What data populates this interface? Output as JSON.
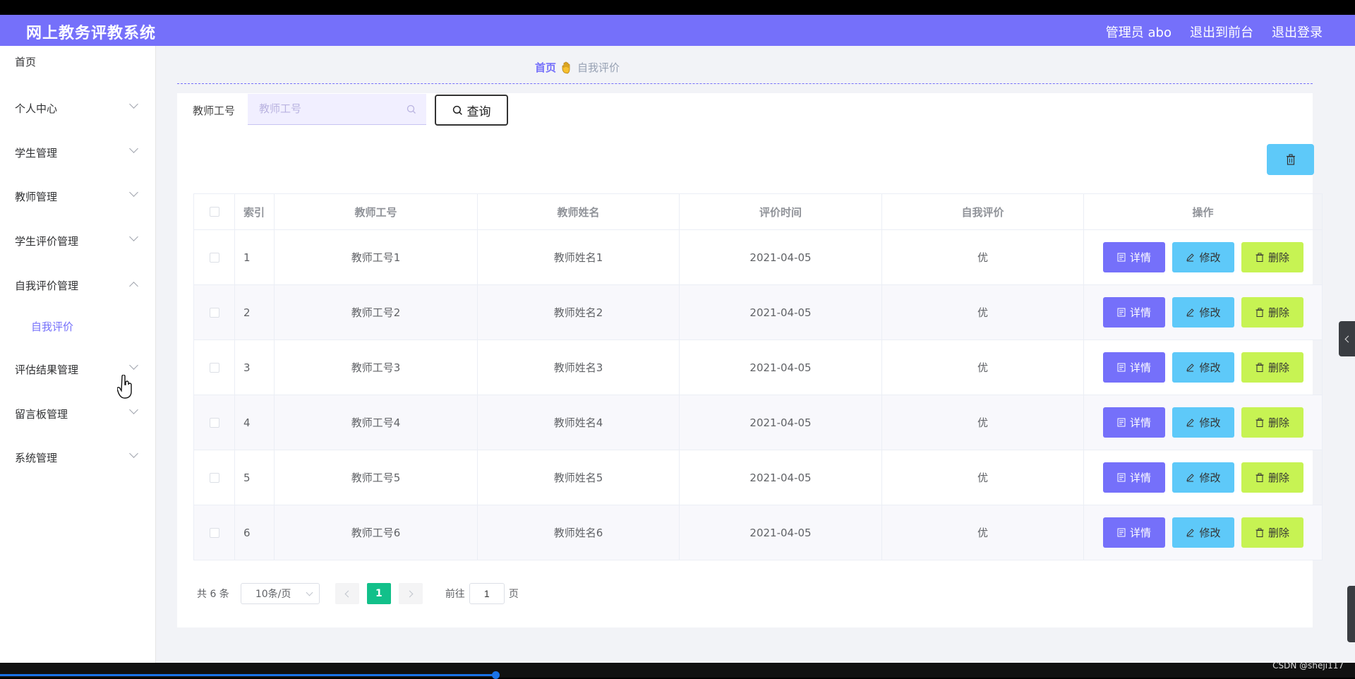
{
  "app": {
    "title": "网上教务评教系统",
    "top_nav": [
      "管理员 abo",
      "退出到前台",
      "退出登录"
    ]
  },
  "sidebar": {
    "items": [
      {
        "label": "首页",
        "has_arrow": false
      },
      {
        "label": "个人中心",
        "has_arrow": true
      },
      {
        "label": "学生管理",
        "has_arrow": true
      },
      {
        "label": "教师管理",
        "has_arrow": true
      },
      {
        "label": "学生评价管理",
        "has_arrow": true
      },
      {
        "label": "自我评价管理",
        "has_arrow": true,
        "expanded": true,
        "children": [
          "自我评价"
        ]
      },
      {
        "label": "评估结果管理",
        "has_arrow": true
      },
      {
        "label": "留言板管理",
        "has_arrow": true
      },
      {
        "label": "系统管理",
        "has_arrow": true
      }
    ]
  },
  "breadcrumb": {
    "home": "首页",
    "current": "自我评价"
  },
  "search": {
    "label": "教师工号",
    "placeholder": "教师工号",
    "value": "",
    "button_label": "查询"
  },
  "table": {
    "columns": [
      "索引",
      "教师工号",
      "教师姓名",
      "评价时间",
      "自我评价",
      "操作"
    ],
    "rows": [
      {
        "index": "1",
        "teacher_no": "教师工号1",
        "teacher_name": "教师姓名1",
        "eval_time": "2021-04-05",
        "self_eval": "优"
      },
      {
        "index": "2",
        "teacher_no": "教师工号2",
        "teacher_name": "教师姓名2",
        "eval_time": "2021-04-05",
        "self_eval": "优"
      },
      {
        "index": "3",
        "teacher_no": "教师工号3",
        "teacher_name": "教师姓名3",
        "eval_time": "2021-04-05",
        "self_eval": "优"
      },
      {
        "index": "4",
        "teacher_no": "教师工号4",
        "teacher_name": "教师姓名4",
        "eval_time": "2021-04-05",
        "self_eval": "优"
      },
      {
        "index": "5",
        "teacher_no": "教师工号5",
        "teacher_name": "教师姓名5",
        "eval_time": "2021-04-05",
        "self_eval": "优"
      },
      {
        "index": "6",
        "teacher_no": "教师工号6",
        "teacher_name": "教师姓名6",
        "eval_time": "2021-04-05",
        "self_eval": "优"
      }
    ],
    "row_actions": {
      "detail": "详情",
      "edit": "修改",
      "delete": "删除"
    }
  },
  "pagination": {
    "total_text": "共 6 条",
    "page_size": "10条/页",
    "current_page": "1",
    "goto_label": "前往",
    "goto_value": "1",
    "page_suffix": "页"
  },
  "watermark": "CSDN @sheji117",
  "colors": {
    "primary": "#7570fa",
    "info": "#5ec9f9",
    "warning": "#c7f353",
    "pager_active": "#12c08a"
  }
}
